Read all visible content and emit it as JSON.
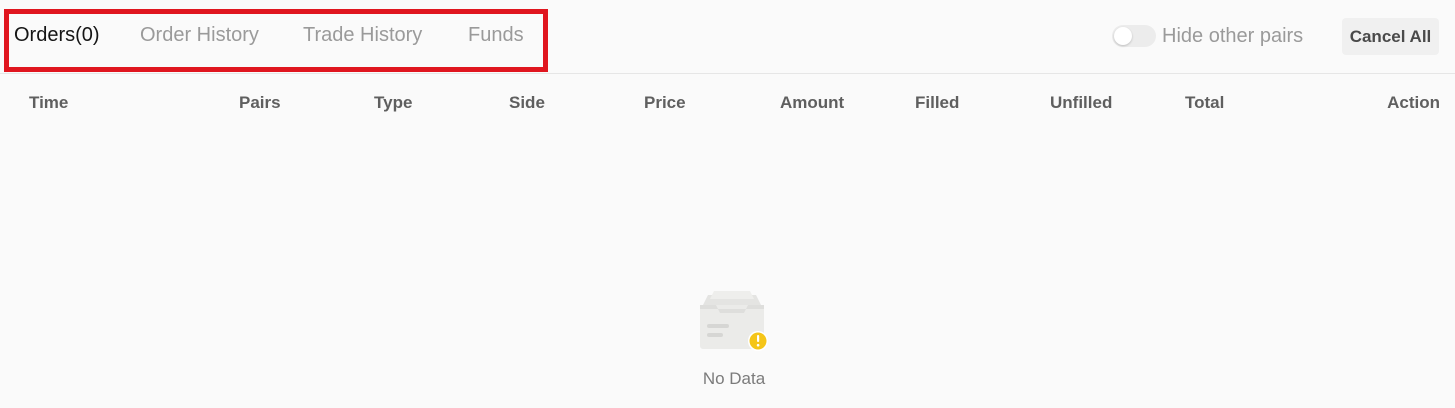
{
  "tabs": [
    {
      "label": "Orders(0)",
      "active": true
    },
    {
      "label": "Order History",
      "active": false
    },
    {
      "label": "Trade History",
      "active": false
    },
    {
      "label": "Funds",
      "active": false
    }
  ],
  "toolbar": {
    "hide_other_pairs_label": "Hide other pairs",
    "hide_other_pairs_on": false,
    "cancel_all_label": "Cancel All"
  },
  "table": {
    "columns": [
      "Time",
      "Pairs",
      "Type",
      "Side",
      "Price",
      "Amount",
      "Filled",
      "Unfilled",
      "Total",
      "Action"
    ],
    "rows": []
  },
  "empty_state": {
    "icon": "empty-inbox-icon",
    "text": "No Data"
  },
  "colors": {
    "highlight_frame": "#e0161f",
    "warning_badge": "#f5c518",
    "background": "#fafafa"
  }
}
